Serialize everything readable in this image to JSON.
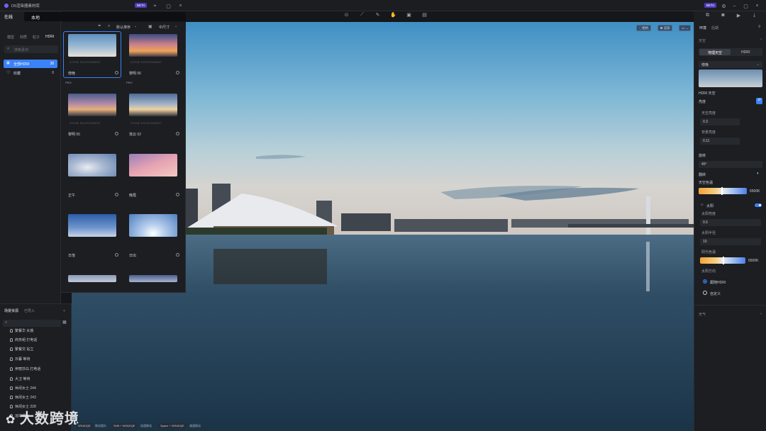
{
  "app": {
    "title": "D5渲染器素材库",
    "beta_badge": "BETA",
    "beta_badge_right": "BETA"
  },
  "lib_tabs": {
    "online": "在线",
    "local": "本地"
  },
  "category_tabs": [
    "模型",
    "材质",
    "粒子",
    "HDRI"
  ],
  "search": {
    "placeholder": "搜索素材"
  },
  "sort": {
    "label": "默认排序",
    "size": "中尺寸"
  },
  "sidebar": {
    "items": [
      {
        "label": "全部HDRI",
        "count": "38"
      },
      {
        "label": "收藏",
        "count": "0"
      }
    ]
  },
  "hdri_items": [
    {
      "name": "傍晚",
      "sub": "SCENE ENVIRONMENT",
      "badge": ""
    },
    {
      "name": "黎明 06",
      "sub": "SCENE ENVIRONMENT",
      "badge": "PRO"
    },
    {
      "name": "黎明 05",
      "sub": "SCENE ENVIRONMENT",
      "badge": "PRO"
    },
    {
      "name": "落云 02",
      "sub": "SCENE ENVIRONMENT",
      "badge": "PRO"
    },
    {
      "name": "正午",
      "sub": "",
      "badge": ""
    },
    {
      "name": "晚霞",
      "sub": "",
      "badge": ""
    },
    {
      "name": "日落",
      "sub": "",
      "badge": ""
    },
    {
      "name": "日出",
      "sub": "",
      "badge": ""
    }
  ],
  "scene_assets": {
    "title": "场景资源",
    "subtitle": "已导入",
    "items": [
      "繁餐华 女装",
      "商务组 打电话",
      "繁餐交 站立",
      "日暮 等待",
      "伊丽莎白 打电话",
      "大卫 等待",
      "休闲女士 244",
      "休闲女士 243",
      "休闲女士 228",
      "运动增片"
    ]
  },
  "viewport_chips": {
    "camera": "相机",
    "preview": "渲染"
  },
  "status_hints": [
    {
      "key": "WSADQE",
      "desc": "移动镜头"
    },
    {
      "key": "Shift + WSADQE",
      "desc": "加速移动"
    },
    {
      "key": "Space + WSADQE",
      "desc": "减速移动"
    }
  ],
  "watermark": "大数跨境",
  "right_panel": {
    "tabs": [
      "环境",
      "后期"
    ],
    "section_sky": "天空",
    "sky_modes": [
      "地理天空",
      "HDRI"
    ],
    "hdri_select": "傍晚",
    "hdri_sky_label": "HDRI 天空",
    "brightness_label": "亮度",
    "sky_brightness_label": "天空亮度",
    "sky_brightness_value": "0.3",
    "bg_brightness_label": "背景亮度",
    "bg_brightness_value": "0.11",
    "rotation_label": "旋转",
    "rotation_value": "45°",
    "flip_label": "翻转",
    "sky_color_label": "天空色温",
    "sky_color_value": "6500K",
    "sun_label": "太阳",
    "sun_brightness_label": "太阳亮度",
    "sun_brightness_value": "0.5",
    "sun_radius_label": "太阳半径",
    "sun_radius_value": "10",
    "light_color_label": "阳光色温",
    "light_color_value": "6500K",
    "sun_direction_label": "太阳方向",
    "sun_dir_options": [
      "跟随HDRI",
      "自定义"
    ],
    "weather_label": "天气"
  },
  "colors": {
    "accent": "#3b82f6",
    "panel": "#1c1e22",
    "beta": "#4a3db8"
  }
}
